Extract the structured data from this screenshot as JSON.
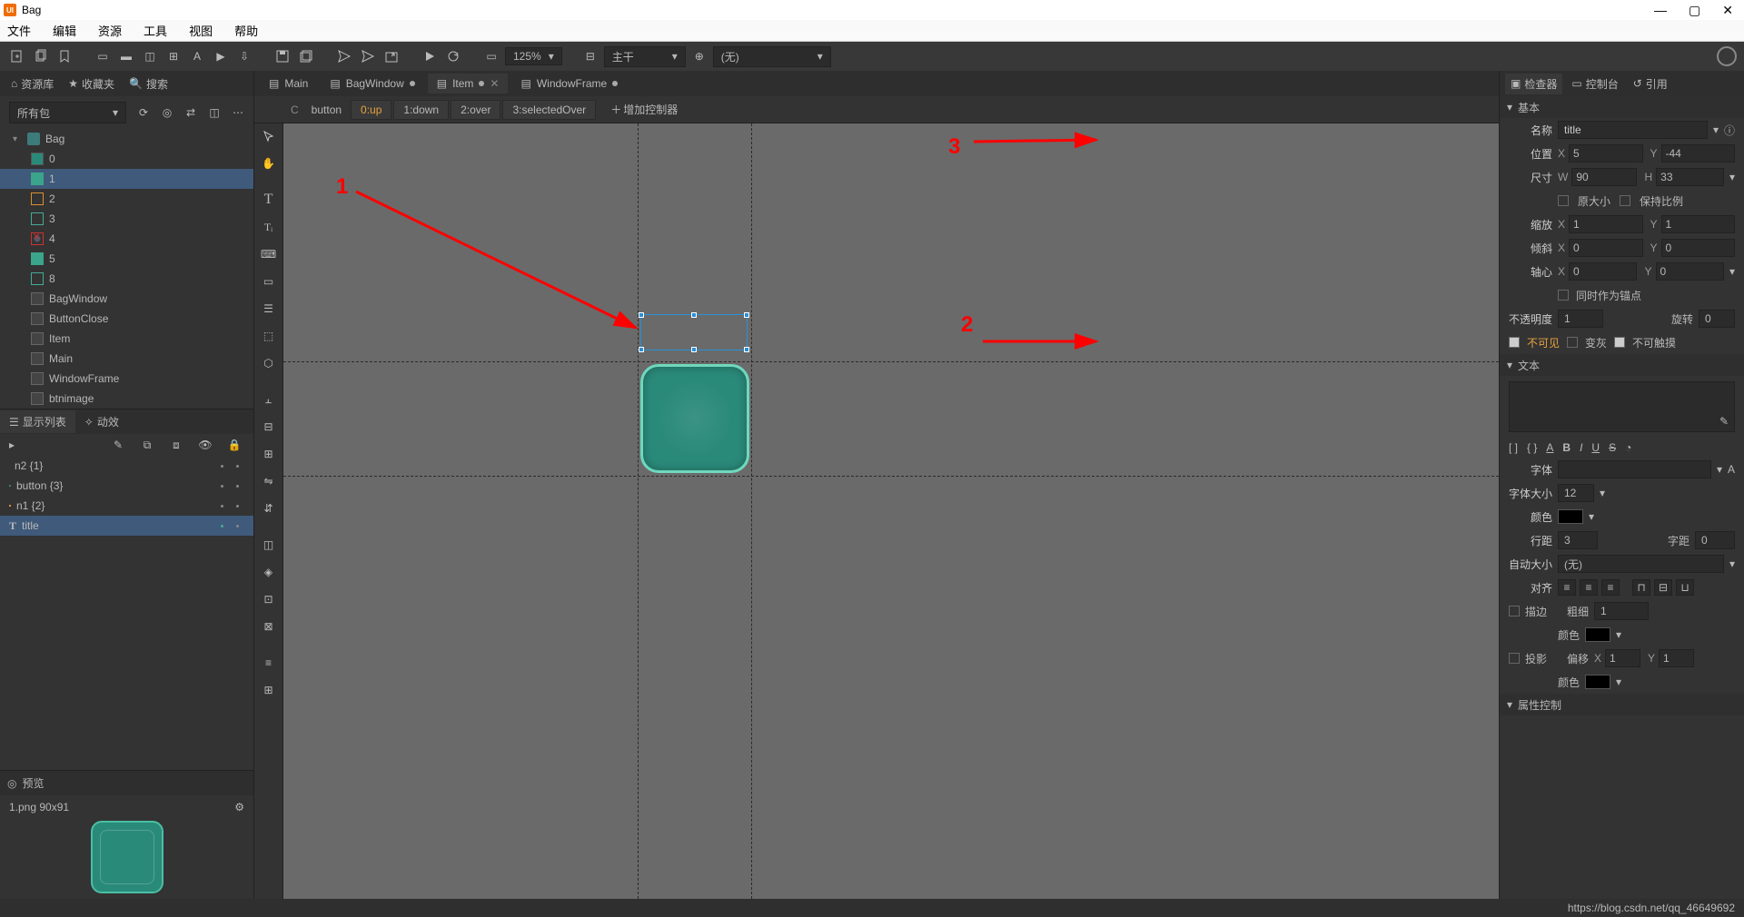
{
  "window": {
    "title": "Bag"
  },
  "menubar": {
    "file": "文件",
    "edit": "编辑",
    "resource": "资源",
    "tool": "工具",
    "view": "视图",
    "help": "帮助"
  },
  "toolbar": {
    "zoom": "125%",
    "layer_label": "主干",
    "scene_label": "(无)"
  },
  "left_tabs": {
    "library": "资源库",
    "favorites": "收藏夹",
    "search": "搜索"
  },
  "package_dropdown": "所有包",
  "asset_tree": {
    "root": "Bag",
    "items": [
      {
        "label": "0"
      },
      {
        "label": "1"
      },
      {
        "label": "2"
      },
      {
        "label": "3"
      },
      {
        "label": "4"
      },
      {
        "label": "5"
      },
      {
        "label": "8"
      },
      {
        "label": "BagWindow"
      },
      {
        "label": "ButtonClose"
      },
      {
        "label": "Item"
      },
      {
        "label": "Main"
      },
      {
        "label": "WindowFrame"
      },
      {
        "label": "btnimage"
      }
    ]
  },
  "mid_tabs": {
    "display_list": "显示列表",
    "effects": "动效"
  },
  "display_list": [
    {
      "label": "n2 {1}"
    },
    {
      "label": "button {3}"
    },
    {
      "label": "n1 {2}"
    },
    {
      "label": "title"
    }
  ],
  "preview": {
    "title": "预览",
    "filename": "1.png  90x91"
  },
  "doc_tabs": [
    {
      "label": "Main",
      "modified": false,
      "active": false
    },
    {
      "label": "BagWindow",
      "modified": true,
      "active": false
    },
    {
      "label": "Item",
      "modified": true,
      "active": true
    },
    {
      "label": "WindowFrame",
      "modified": true,
      "active": false
    }
  ],
  "controller": {
    "name": "button",
    "states": [
      "0:up",
      "1:down",
      "2:over",
      "3:selectedOver"
    ],
    "add": "增加控制器"
  },
  "annotations": {
    "n1": "1",
    "n2": "2",
    "n3": "3"
  },
  "inspector_tabs": {
    "inspector": "检查器",
    "console": "控制台",
    "reference": "引用"
  },
  "basic": {
    "section": "基本",
    "name_label": "名称",
    "name_value": "title",
    "pos_label": "位置",
    "x": "5",
    "y": "-44",
    "size_label": "尺寸",
    "w": "90",
    "h": "33",
    "orig_size": "原大小",
    "keep_ratio": "保持比例",
    "scale_label": "缩放",
    "sx": "1",
    "sy": "1",
    "skew_label": "倾斜",
    "kx": "0",
    "ky": "0",
    "pivot_label": "轴心",
    "px": "0",
    "py": "0",
    "pivot_anchor": "同时作为锚点",
    "opacity_label": "不透明度",
    "opacity": "1",
    "rotation_label": "旋转",
    "rotation": "0",
    "invisible": "不可见",
    "grayed": "变灰",
    "untouchable": "不可触摸"
  },
  "text": {
    "section": "文本",
    "font_label": "字体",
    "font_size_label": "字体大小",
    "font_size": "12",
    "color_label": "颜色",
    "leading_label": "行距",
    "leading": "3",
    "letter_label": "字距",
    "letter": "0",
    "autosize_label": "自动大小",
    "autosize": "(无)",
    "align_label": "对齐",
    "stroke_label": "描边",
    "stroke_thick_label": "粗细",
    "stroke_thick": "1",
    "stroke_color_label": "颜色",
    "shadow_label": "投影",
    "offset_label": "偏移",
    "ox": "1",
    "oy": "1",
    "shadow_color_label": "颜色"
  },
  "attr_control": {
    "section": "属性控制"
  },
  "status": "https://blog.csdn.net/qq_46649692"
}
